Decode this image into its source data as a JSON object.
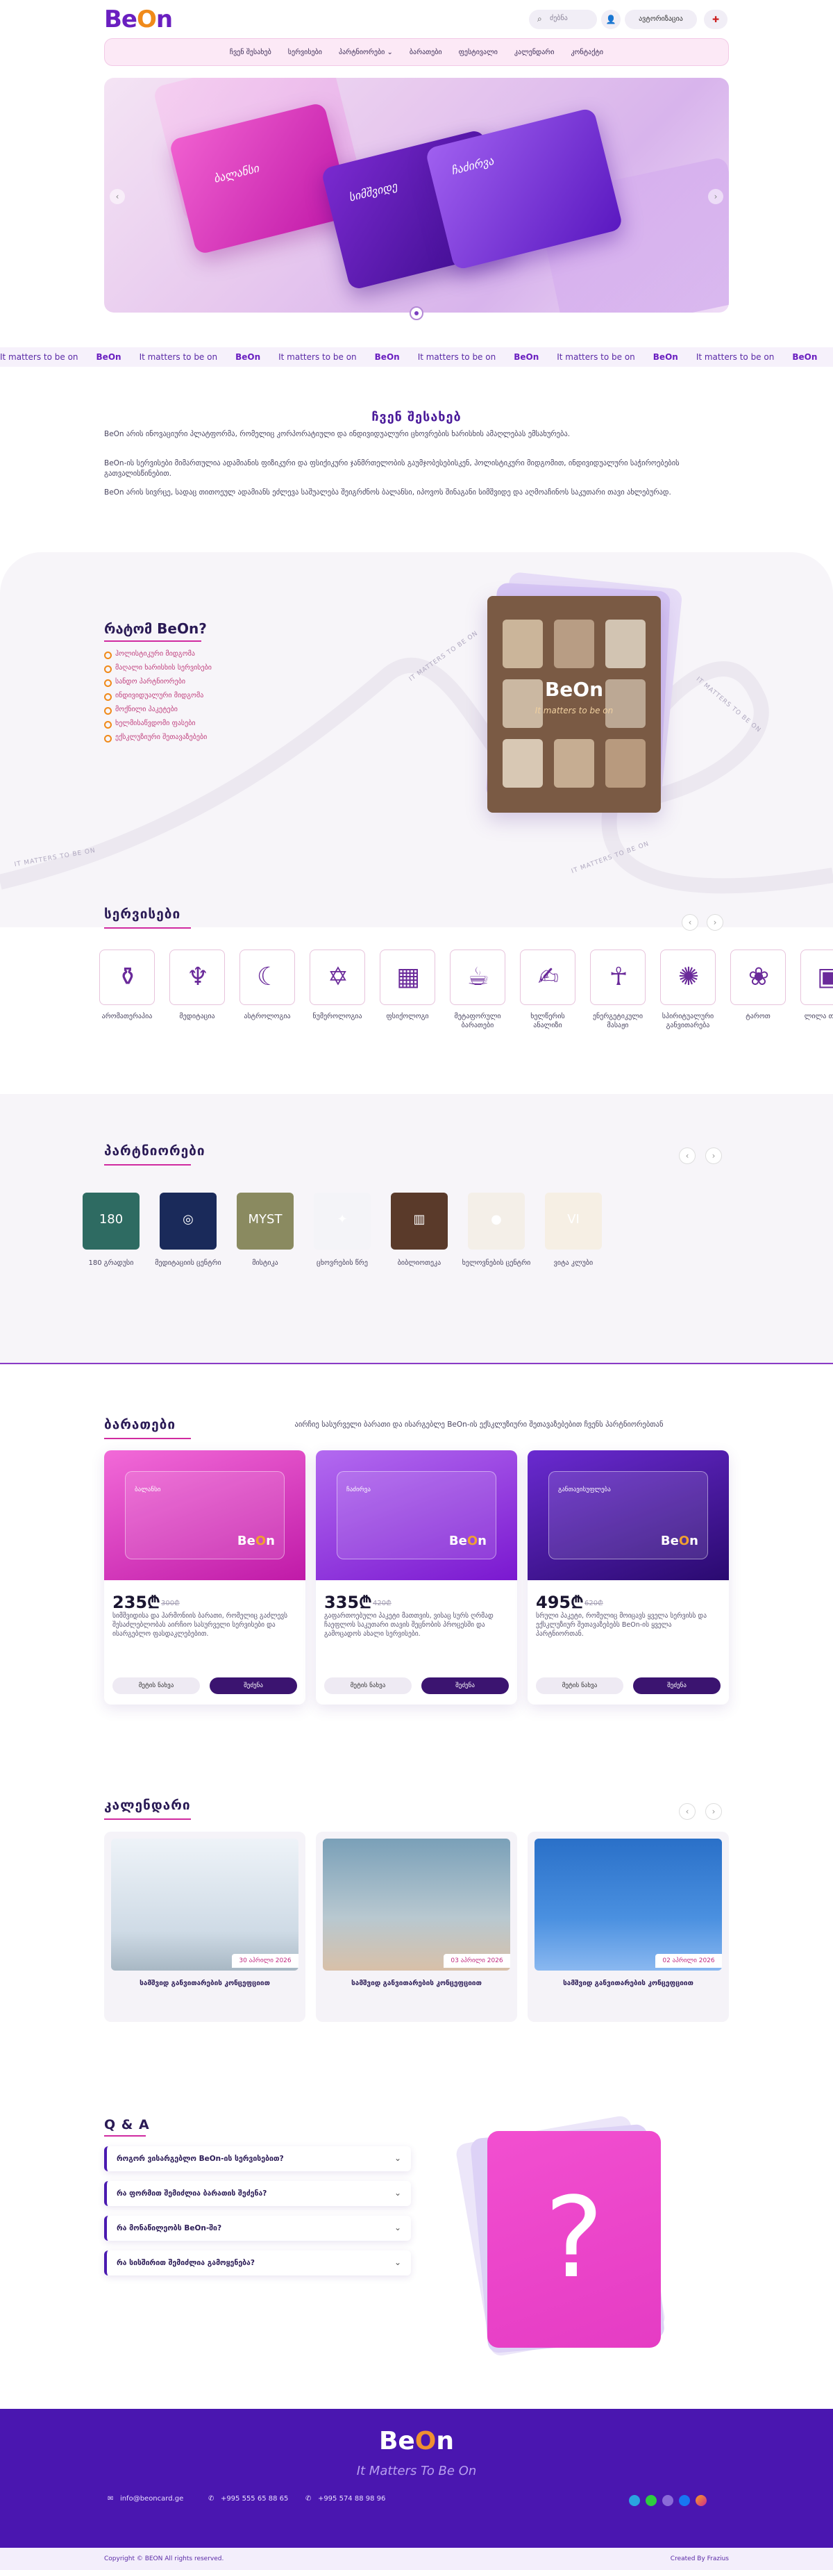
{
  "header": {
    "logo_left": "Be",
    "logo_o": "O",
    "logo_right": "n",
    "search_placeholder": "ძებნა",
    "auth_label": "ავტორიზაცია",
    "nav": [
      "ჩვენ შესახებ",
      "სერვისები",
      "პარტნიორები",
      "ბარათები",
      "ფესტივალი",
      "კალენდარი",
      "კონტაქტი"
    ]
  },
  "hero": {
    "card_texts": [
      "ბალანსი",
      "სიმშვიდე",
      "ჩაძირვა"
    ]
  },
  "marquee": {
    "text": "It matters to be on",
    "logo": "BeOn"
  },
  "about": {
    "title": "ჩვენ შესახებ",
    "p1": "BeOn არის ინოვაციური პლატფორმა, რომელიც კორპორატიული და ინდივიდუალური ცხოვრების ხარისხის ამაღლებას ემსახურება.",
    "p2": "BeOn-ის სერვისები მიმართულია ადამიანის ფიზიკური და ფსიქიკური ჯანმრთელობის გაუმჯობესებისკენ, ჰოლისტიკური მიდგომით, ინდივიდუალური საჭიროებების გათვალისწინებით.",
    "p3": "BeOn არის სივრცე, სადაც თითოეულ ადამიანს ეძლევა საშუალება შეიგრძნოს ბალანსი, იპოვოს შინაგანი სიმშვიდე და აღმოაჩინოს საკუთარი თავი ახლებურად."
  },
  "why": {
    "title": "რატომ BeOn?",
    "items": [
      "ჰოლისტიკური მიდგომა",
      "მაღალი ხარისხის სერვისები",
      "სანდო პარტნიორები",
      "ინდივიდუალური მიდგომა",
      "მოქნილი პაკეტები",
      "ხელმისაწვდომი ფასები",
      "ექსკლუზიური შეთავაზებები"
    ],
    "book_logo": "BeOn",
    "book_sub": "It matters to be on",
    "loop_text": "IT MATTERS TO BE ON"
  },
  "services": {
    "title": "სერვისები",
    "items": [
      {
        "icon": "⚱",
        "label": "არომათერაპია"
      },
      {
        "icon": "♆",
        "label": "მედიტაცია"
      },
      {
        "icon": "☾",
        "label": "ასტროლოგია"
      },
      {
        "icon": "✡",
        "label": "ნუმეროლოგია"
      },
      {
        "icon": "▦",
        "label": "ფსიქოლოგი"
      },
      {
        "icon": "☕",
        "label": "მეტაფორული ბარათები"
      },
      {
        "icon": "✍",
        "label": "ხელწერის ანალიზი"
      },
      {
        "icon": "☥",
        "label": "ენერგეტიკული მასაჟი"
      },
      {
        "icon": "✺",
        "label": "სპირიტუალური განვითარება"
      },
      {
        "icon": "❀",
        "label": "ტაროთ"
      },
      {
        "icon": "▣",
        "label": "ლილა თამაში"
      }
    ]
  },
  "partners": {
    "title": "პარტნიორები",
    "items": [
      {
        "label": "180 გრადუსი",
        "text": "180",
        "color": "#2e6b62"
      },
      {
        "label": "მედიტაციის ცენტრი",
        "text": "◎",
        "color": "#1a2a5a"
      },
      {
        "label": "მისტიკა",
        "text": "MYST",
        "color": "#8a8a60"
      },
      {
        "label": "ცხოვრების წრე",
        "text": "✦",
        "color": "#f4f4f8"
      },
      {
        "label": "ბიბლიოთეკა",
        "text": "▥",
        "color": "#5a3a2a"
      },
      {
        "label": "ხელოვნების ცენტრი",
        "text": "●",
        "color": "#f4efe8"
      },
      {
        "label": "ვიტა კლუბი",
        "text": "VI",
        "color": "#f6efe4"
      }
    ]
  },
  "cards": {
    "title": "ბარათები",
    "description": "აირჩიე სასურველი ბარათი და ისარგებლე BeOn-ის ექსკლუზიური შეთავაზებებით ჩვენს პარტნიორებთან",
    "items": [
      {
        "name": "ბალანსი",
        "price": "235₾",
        "old": "300₾",
        "desc": "სიმშვიდისა და ჰარმონიის ბარათი, რომელიც გაძლევს შესაძლებლობას აირჩიო სასურველი სერვისები და ისარგებლო ფასდაკლებებით.",
        "btn1": "მეტის ნახვა",
        "btn2": "შეძენა"
      },
      {
        "name": "ჩაძირვა",
        "price": "335₾",
        "old": "420₾",
        "desc": "გაფართოებული პაკეტი მათთვის, ვისაც სურს ღრმად ჩაეფლოს საკუთარი თავის შეცნობის პროცესში და გამოცადოს ახალი სერვისები.",
        "btn1": "მეტის ნახვა",
        "btn2": "შეძენა"
      },
      {
        "name": "განთავისუფლება",
        "price": "495₾",
        "old": "620₾",
        "desc": "სრული პაკეტი, რომელიც მოიცავს ყველა სერვისს და ექსკლუზიურ შეთავაზებებს BeOn-ის ყველა პარტნიორთან.",
        "btn1": "მეტის ნახვა",
        "btn2": "შეძენა"
      }
    ]
  },
  "calendar": {
    "title": "კალენდარი",
    "events": [
      {
        "date": "30 აპრილი 2026",
        "title": "სამშვიდ განვითარების კონცეფციით"
      },
      {
        "date": "03 აპრილი 2026",
        "title": "სამშვიდ განვითარების კონცეფციით"
      },
      {
        "date": "02 აპრილი 2026",
        "title": "სამშვიდ განვითარების კონცეფციით"
      }
    ]
  },
  "faq": {
    "title": "Q & A",
    "items": [
      "როგორ ვისარგებლო BeOn-ის სერვისებით?",
      "რა ფორმით შემიძლია ბარათის შეძენა?",
      "რა მონაწილეობს BeOn-ში?",
      "რა სისშირით შემიძლია გამოყენება?"
    ],
    "question_mark": "?"
  },
  "footer": {
    "logo_left": "Be",
    "logo_o": "O",
    "logo_right": "n",
    "tagline": "It Matters To Be On",
    "email": "info@beoncard.ge",
    "phone1": "+995 555 65 88 65",
    "phone2": "+995 574 88 98 96",
    "copyright": "Copyright © BEON All rights reserved.",
    "credit": "Created By Frazius"
  }
}
